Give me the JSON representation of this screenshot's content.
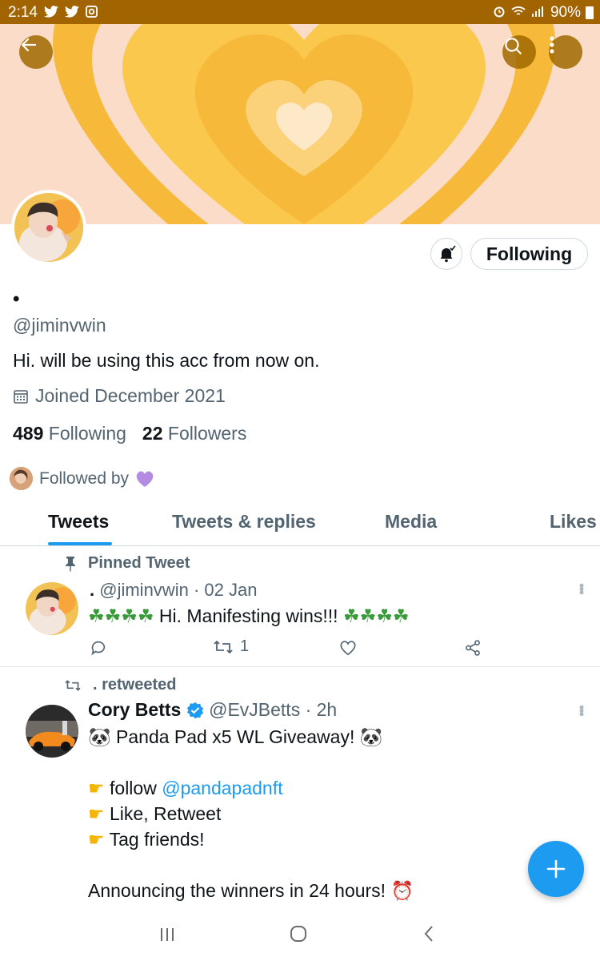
{
  "status_bar": {
    "time": "2:14",
    "battery": "90%"
  },
  "profile": {
    "display_name": "•",
    "handle": "@jiminvwin",
    "bio": "Hi. will be using this acc from now on.",
    "joined": "Joined December 2021",
    "following_count": "489",
    "following_label": "Following",
    "followers_count": "22",
    "followers_label": "Followers",
    "followed_by": "Followed by",
    "follow_button": "Following"
  },
  "tabs": [
    {
      "label": "Tweets",
      "active": true
    },
    {
      "label": "Tweets & replies",
      "active": false
    },
    {
      "label": "Media",
      "active": false
    },
    {
      "label": "Likes",
      "active": false
    }
  ],
  "pinned_tweet": {
    "pinned_label": "Pinned Tweet",
    "name": ".",
    "handle": "@jiminvwin",
    "date": "· 02 Jan",
    "text": "Hi. Manifesting wins!!!",
    "retweets": "1"
  },
  "retweet": {
    "retweeted_label": ". retweeted",
    "name": "Cory Betts",
    "handle": "@EvJBetts",
    "time": "· 2h",
    "line1": "Panda Pad x5 WL Giveaway!",
    "line2_prefix": "follow",
    "line2_link": "@pandapadnft",
    "line3": "Like, Retweet",
    "line4": "Tag friends!",
    "line5": "Announcing the winners in 24 hours!"
  },
  "colors": {
    "accent": "#1d9bf0",
    "status_bar": "#a26400",
    "banner_bg": "#fbdcc8"
  }
}
